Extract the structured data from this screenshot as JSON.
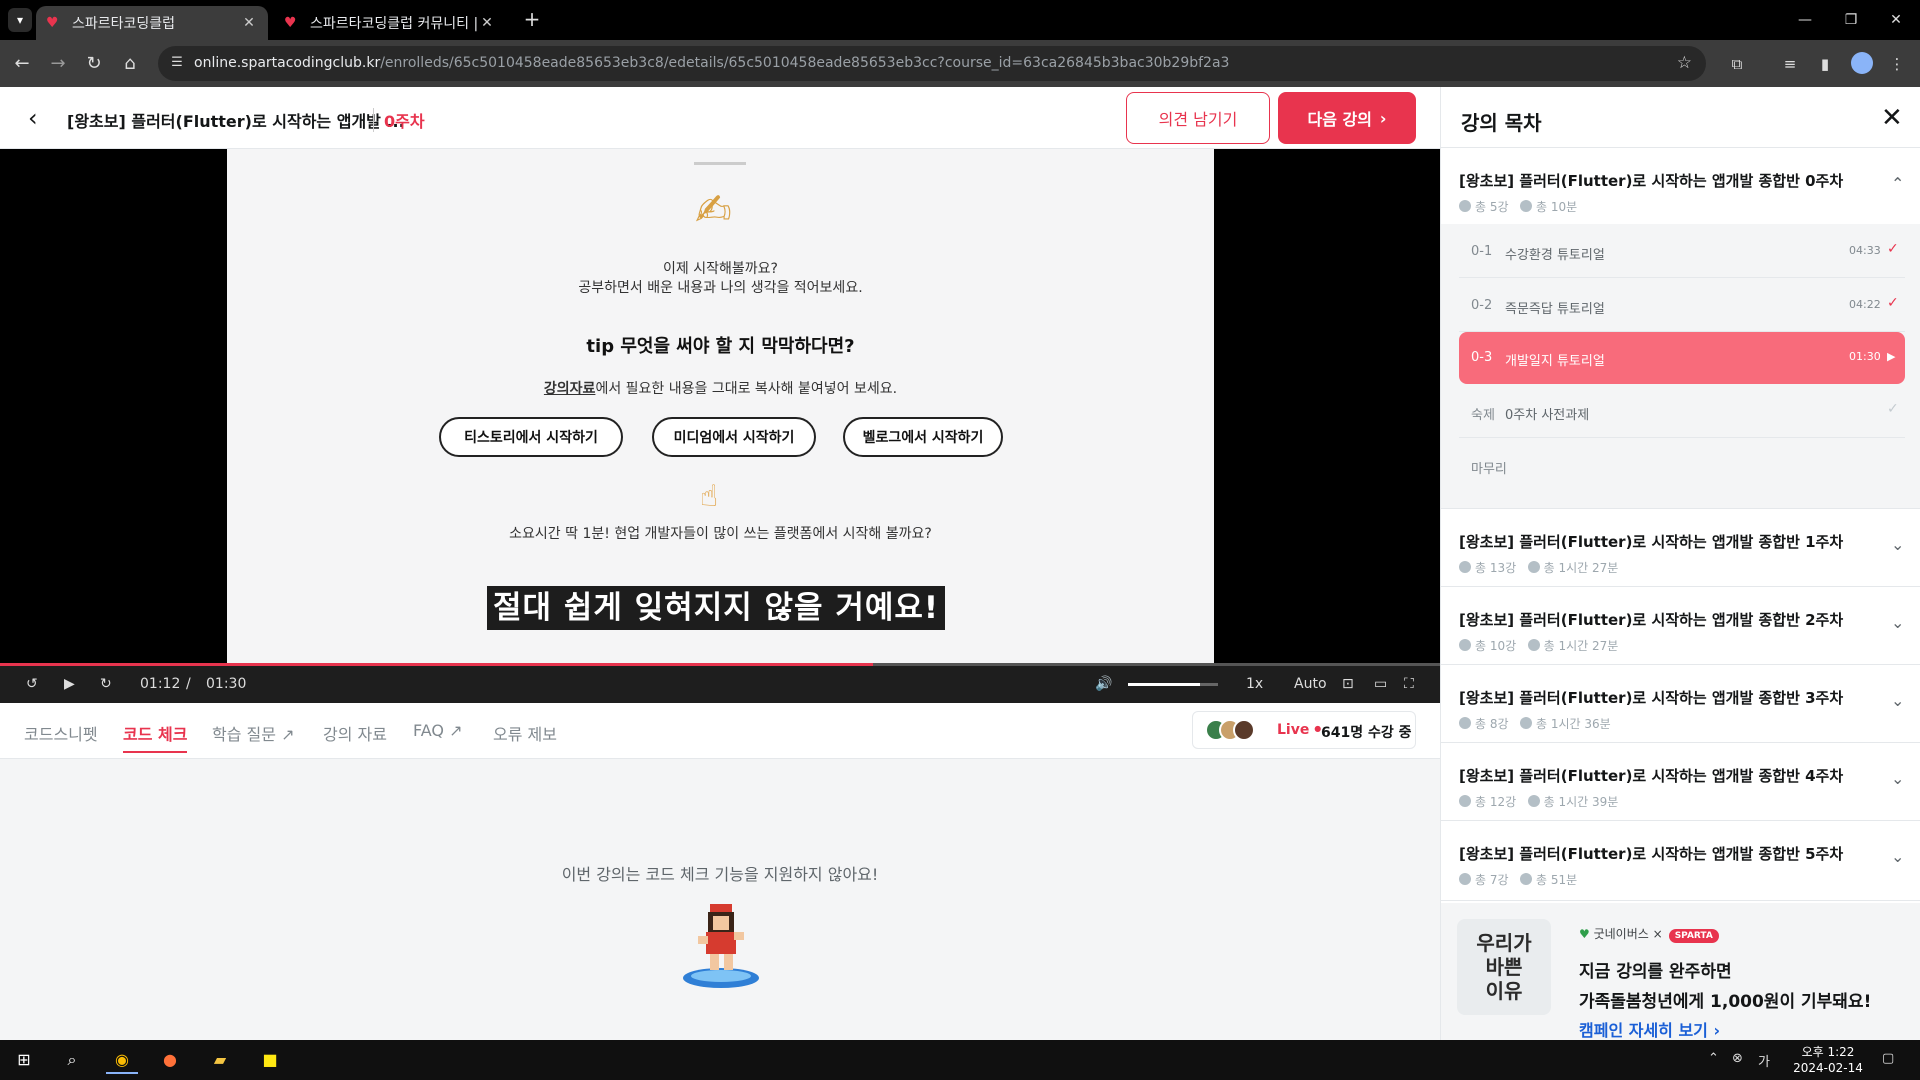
{
  "browser": {
    "tabs": [
      {
        "title": "스파르타코딩클럽",
        "active": true
      },
      {
        "title": "스파르타코딩클럽 커뮤니티 | 스",
        "active": false
      }
    ],
    "url_host": "online.spartacodingclub.kr",
    "url_path": "/enrolleds/65c5010458eade85653eb3c8/edetails/65c5010458eade85653eb3cc?course_id=63ca26845b3bac30b29bf2a3"
  },
  "header": {
    "course_title": "[왕초보] 플러터(Flutter)로 시작하는 앱개발 ...",
    "week": "0주차",
    "feedback_label": "의견 남기기",
    "next_label": "다음 강의"
  },
  "video": {
    "slide": {
      "line1": "이제 시작해볼까요?",
      "line2": "공부하면서 배운 내용과 나의 생각을 적어보세요.",
      "tip": "tip 무엇을 써야 할 지 막막하다면?",
      "material_link": "강의자료",
      "material_rest": "에서 필요한 내용을 그대로 복사해 붙여넣어 보세요.",
      "buttons": [
        "티스토리에서 시작하기",
        "미디엄에서 시작하기",
        "벨로그에서 시작하기"
      ],
      "bottom": "소요시간 딱 1분! 현업 개발자들이 많이 쓰는 플랫폼에서 시작해 볼까요?",
      "caption": "절대 쉽게 잊혀지지 않을 거예요!"
    },
    "current_time": "01:12",
    "separator": "/",
    "total_time": "01:30",
    "progress": 0.606,
    "volume": 0.8,
    "speed": "1x",
    "quality": "Auto"
  },
  "tabs": {
    "items": [
      "코드스니펫",
      "코드 체크",
      "학습 질문",
      "강의 자료",
      "FAQ",
      "오류 제보"
    ],
    "active": 1,
    "live_label": "Live",
    "live_count": "641명 수강 중"
  },
  "code_check": {
    "message": "이번 강의는 코드 체크 기능을 지원하지 않아요!"
  },
  "sidebar": {
    "title": "강의 목차",
    "weeks": [
      {
        "title": "[왕초보] 플러터(Flutter)로 시작하는 앱개발 종합반 0주차",
        "count": "총 5강",
        "time": "총 10분"
      },
      {
        "title": "[왕초보] 플러터(Flutter)로 시작하는 앱개발 종합반 1주차",
        "count": "총 13강",
        "time": "총 1시간 27분"
      },
      {
        "title": "[왕초보] 플러터(Flutter)로 시작하는 앱개발 종합반 2주차",
        "count": "총 10강",
        "time": "총 1시간 27분"
      },
      {
        "title": "[왕초보] 플러터(Flutter)로 시작하는 앱개발 종합반 3주차",
        "count": "총 8강",
        "time": "총 1시간 36분"
      },
      {
        "title": "[왕초보] 플러터(Flutter)로 시작하는 앱개발 종합반 4주차",
        "count": "총 12강",
        "time": "총 1시간 39분"
      },
      {
        "title": "[왕초보] 플러터(Flutter)로 시작하는 앱개발 종합반 5주차",
        "count": "총 7강",
        "time": "총 51분"
      }
    ],
    "lessons": [
      {
        "num": "0-1",
        "title": "수강환경 튜토리얼",
        "duration": "04:33",
        "status": "done"
      },
      {
        "num": "0-2",
        "title": "즉문즉답 튜토리얼",
        "duration": "04:22",
        "status": "done"
      },
      {
        "num": "0-3",
        "title": "개발일지 튜토리얼",
        "duration": "01:30",
        "status": "playing"
      },
      {
        "num": "숙제",
        "title": "0주차 사전과제",
        "duration": "",
        "status": "pending"
      },
      {
        "num": "",
        "title": "마무리",
        "duration": "",
        "status": "none"
      }
    ],
    "banner": {
      "logo_text": "우리가\n바쁜\n이유",
      "partner": "굿네이버스",
      "times": "×",
      "sparta": "SPARTA",
      "line1": "지금 강의를 완주하면",
      "line2": "가족돌봄청년에게 1,000원이 기부돼요!",
      "link": "캠페인 자세히 보기"
    }
  },
  "taskbar": {
    "time": "오후 1:22",
    "date": "2024-02-14"
  },
  "colors": {
    "accent": "#e8344e",
    "current_lesson": "#f86b7b",
    "link": "#1a5fd6"
  }
}
